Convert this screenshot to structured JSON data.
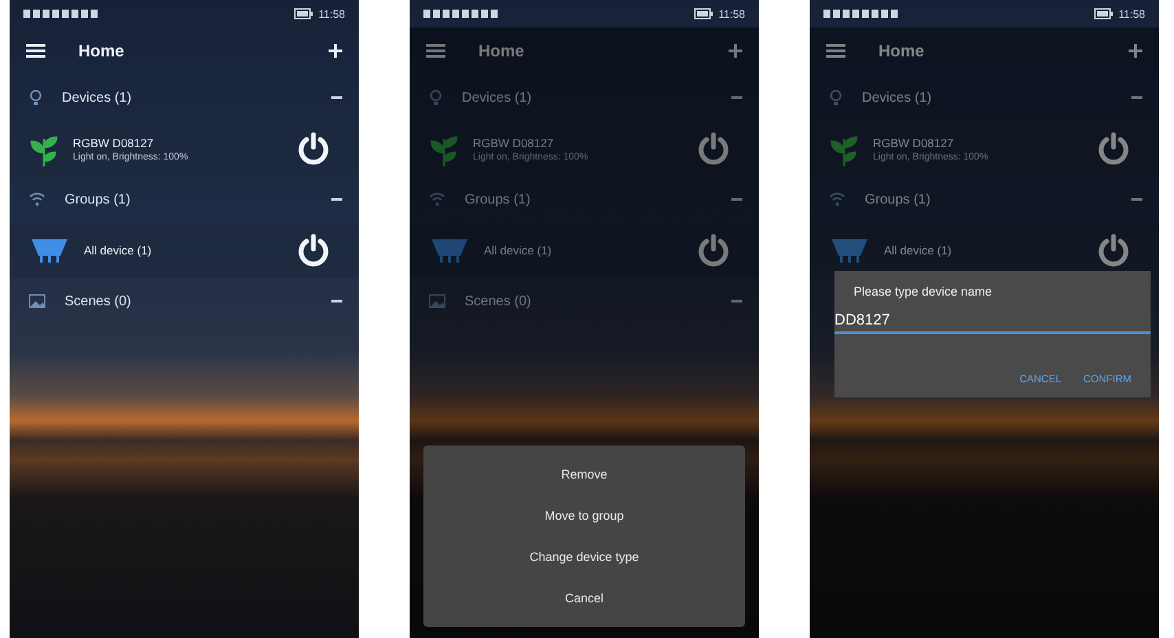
{
  "screens": [
    {
      "status_bar": {
        "time": "11:58"
      },
      "app_bar": {
        "title": "Home"
      },
      "sections": [
        {
          "kind": "devices",
          "title": "Devices (1)",
          "items": [
            {
              "kind": "device",
              "name": "RGBW D08127",
              "detail": "Light on, Brightness: 100%"
            }
          ]
        },
        {
          "kind": "groups",
          "title": "Groups (1)",
          "items": [
            {
              "kind": "group",
              "name": "All device (1)"
            }
          ]
        },
        {
          "kind": "scenes",
          "title": "Scenes (0)"
        }
      ],
      "overlay": {
        "kind": "none"
      }
    },
    {
      "status_bar": {
        "time": "11:58"
      },
      "app_bar": {
        "title": "Home"
      },
      "sections": [
        {
          "kind": "devices",
          "title": "Devices (1)",
          "items": [
            {
              "kind": "device",
              "name": "RGBW D08127",
              "detail": "Light on, Brightness: 100%"
            }
          ]
        },
        {
          "kind": "groups",
          "title": "Groups (1)",
          "items": [
            {
              "kind": "group",
              "name": "All device (1)"
            }
          ]
        },
        {
          "kind": "scenes",
          "title": "Scenes (0)"
        }
      ],
      "overlay": {
        "kind": "action_sheet",
        "options": [
          "Remove",
          "Move to group",
          "Change device type",
          "Cancel"
        ]
      }
    },
    {
      "status_bar": {
        "time": "11:58"
      },
      "app_bar": {
        "title": "Home"
      },
      "sections": [
        {
          "kind": "devices",
          "title": "Devices (1)",
          "items": [
            {
              "kind": "device",
              "name": "RGBW D08127",
              "detail": "Light on, Brightness: 100%"
            }
          ]
        },
        {
          "kind": "groups",
          "title": "Groups (1)",
          "items": [
            {
              "kind": "group",
              "name": "All device (1)"
            }
          ]
        }
      ],
      "overlay": {
        "kind": "input_dialog",
        "title": "Please type device name",
        "value": "DD8127",
        "buttons": [
          "CANCEL",
          "CONFIRM"
        ]
      }
    }
  ]
}
